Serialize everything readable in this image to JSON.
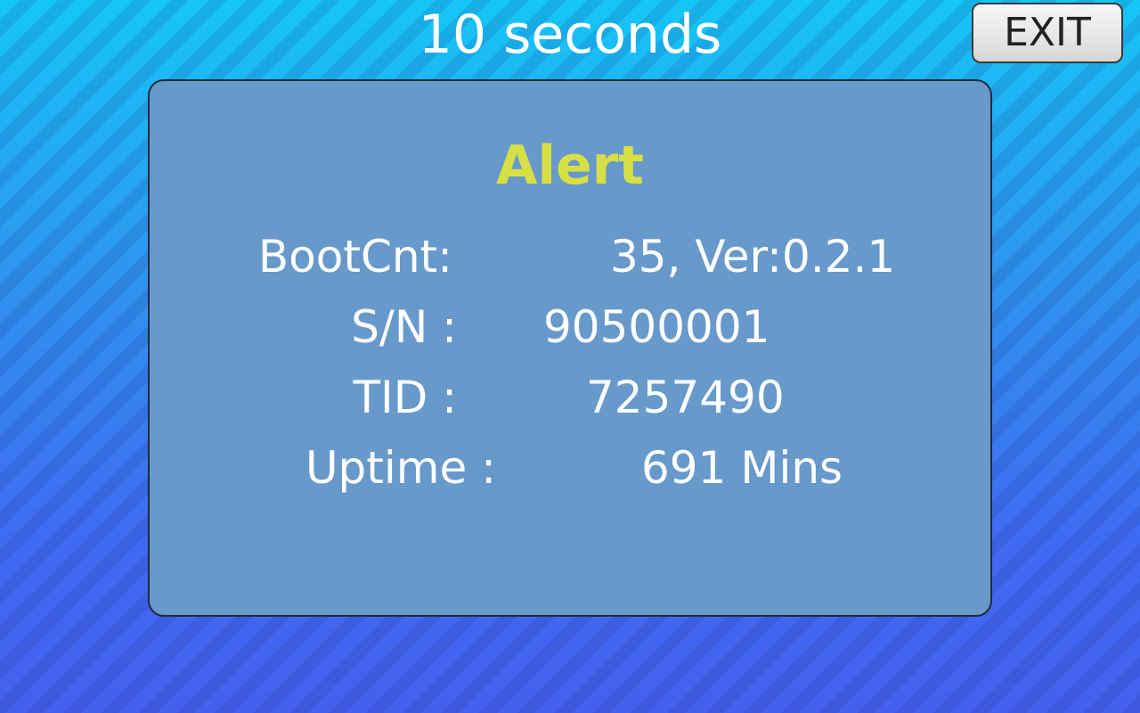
{
  "header": {
    "countdown": "10 seconds",
    "exit_label": "EXIT"
  },
  "alert": {
    "title": "Alert",
    "rows": [
      {
        "label": "BootCnt:",
        "value": "35, Ver:0.2.1"
      },
      {
        "label": "S/N :",
        "value": "90500001"
      },
      {
        "label": "TID :",
        "value": "7257490"
      },
      {
        "label": "Uptime :",
        "value": "691 Mins"
      }
    ]
  },
  "colors": {
    "background_top": "#16c6f7",
    "background_bottom": "#4560ee",
    "panel": "#6799ca",
    "title": "#d8df45",
    "text": "#ffffff"
  }
}
